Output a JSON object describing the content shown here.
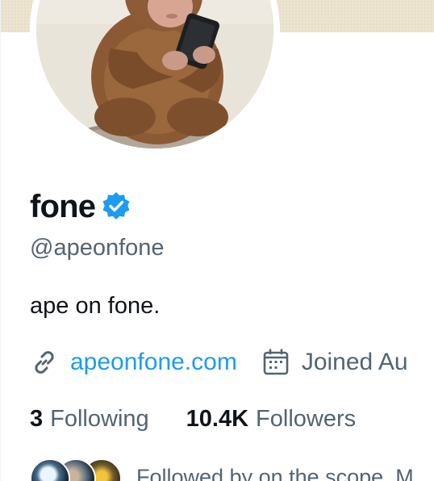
{
  "profile": {
    "display_name": "fone",
    "handle": "@apeonfone",
    "bio": "ape on fone.",
    "website": "apeonfone.com",
    "joined": "Joined Au",
    "verified": true
  },
  "stats": {
    "following_count": "3",
    "following_label": "Following",
    "followers_count": "10.4K",
    "followers_label": "Followers"
  },
  "followed_by": {
    "text": "Followed by on the scope, M"
  },
  "icons": {
    "verified": "verified-badge-icon",
    "link": "link-icon",
    "calendar": "calendar-icon"
  },
  "colors": {
    "accent": "#1d9bf0",
    "verified_blue": "#1d9bf0",
    "text_primary": "#0f1419",
    "text_secondary": "#536471",
    "banner": "#ece4cf"
  }
}
